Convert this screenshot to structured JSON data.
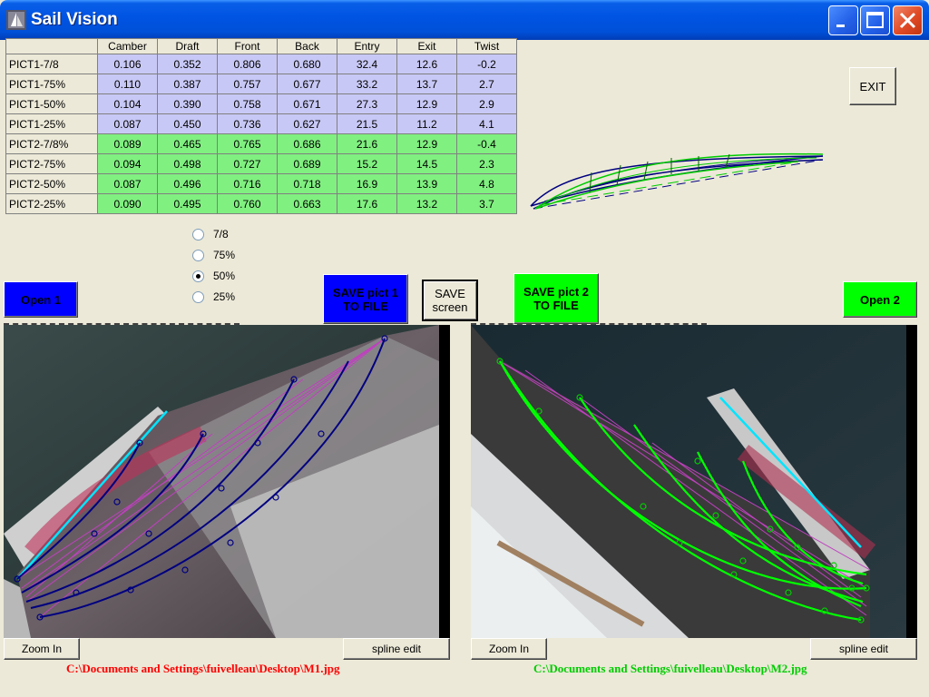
{
  "window": {
    "title": "Sail Vision",
    "icon": "sail-app-icon"
  },
  "table": {
    "columns": [
      "Camber",
      "Draft",
      "Front",
      "Back",
      "Entry",
      "Exit",
      "Twist"
    ],
    "rows": [
      {
        "label": "PICT1-7/8",
        "group": "p1",
        "values": [
          "0.106",
          "0.352",
          "0.806",
          "0.680",
          "32.4",
          "12.6",
          "-0.2"
        ]
      },
      {
        "label": "PICT1-75%",
        "group": "p1",
        "values": [
          "0.110",
          "0.387",
          "0.757",
          "0.677",
          "33.2",
          "13.7",
          "2.7"
        ]
      },
      {
        "label": "PICT1-50%",
        "group": "p1",
        "values": [
          "0.104",
          "0.390",
          "0.758",
          "0.671",
          "27.3",
          "12.9",
          "2.9"
        ]
      },
      {
        "label": "PICT1-25%",
        "group": "p1",
        "values": [
          "0.087",
          "0.450",
          "0.736",
          "0.627",
          "21.5",
          "11.2",
          "4.1"
        ]
      },
      {
        "label": "PICT2-7/8%",
        "group": "p2",
        "values": [
          "0.089",
          "0.465",
          "0.765",
          "0.686",
          "21.6",
          "12.9",
          "-0.4"
        ]
      },
      {
        "label": "PICT2-75%",
        "group": "p2",
        "values": [
          "0.094",
          "0.498",
          "0.727",
          "0.689",
          "15.2",
          "14.5",
          "2.3"
        ]
      },
      {
        "label": "PICT2-50%",
        "group": "p2",
        "values": [
          "0.087",
          "0.496",
          "0.716",
          "0.718",
          "16.9",
          "13.9",
          "4.8"
        ]
      },
      {
        "label": "PICT2-25%",
        "group": "p2",
        "values": [
          "0.090",
          "0.495",
          "0.760",
          "0.663",
          "17.6",
          "13.2",
          "3.7"
        ]
      }
    ]
  },
  "radio": {
    "options": [
      "7/8",
      "75%",
      "50%",
      "25%"
    ],
    "selected": "50%"
  },
  "buttons": {
    "exit": "EXIT",
    "open1": "Open 1",
    "save1": "SAVE pict 1 TO FILE",
    "save_screen": "SAVE screen",
    "save2": "SAVE pict 2 TO FILE",
    "open2": "Open 2",
    "zoom_in": "Zoom In",
    "spline_edit": "spline edit"
  },
  "files": {
    "pict1": "C:\\Documents and Settings\\fuivelleau\\Desktop\\M1.jpg",
    "pict2": "C:\\Documents and Settings\\fuivelleau\\Desktop\\M2.jpg"
  },
  "colors": {
    "pict1_accent": "#0000ff",
    "pict2_accent": "#00ff00",
    "pict1_path": "#ff0000",
    "pict2_path": "#00cc00",
    "table_p1": "#c8c8f6",
    "table_p2": "#80f080",
    "luff_line": "#00e5ff"
  }
}
